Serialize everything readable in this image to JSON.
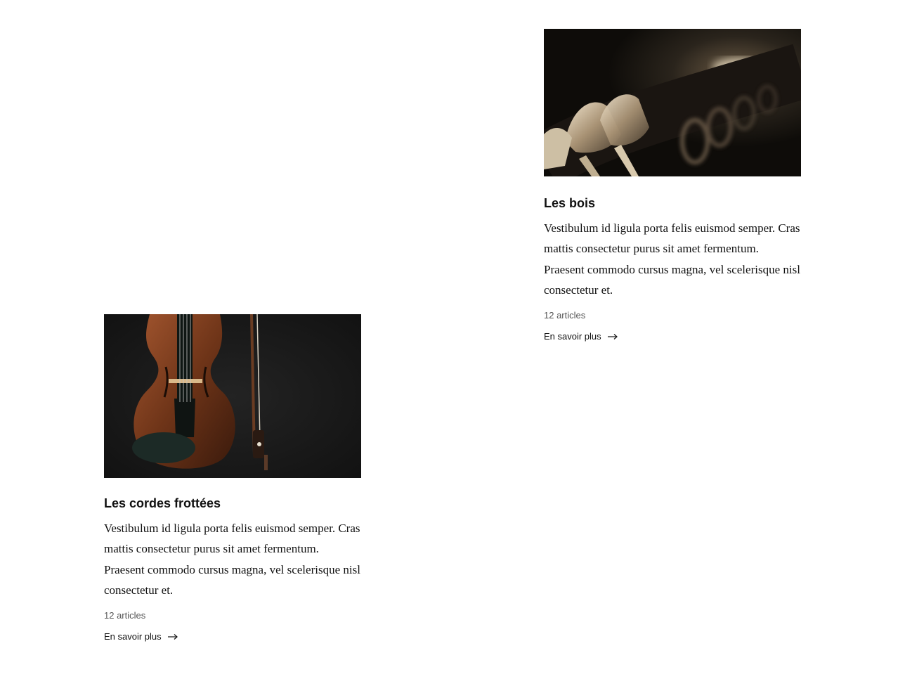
{
  "cards": [
    {
      "id": "bois",
      "image_icon": "clarinet-keys-photo",
      "title": "Les bois",
      "description": "Vestibulum id ligula porta felis euismod semper. Cras mattis consectetur purus sit amet fermentum. Praesent commodo cursus magna, vel scelerisque nisl consectetur et.",
      "count": "12 articles",
      "link_label": "En savoir plus",
      "link_icon": "arrow-right-icon"
    },
    {
      "id": "cordes",
      "image_icon": "violin-photo",
      "title": "Les cordes frottées",
      "description": "Vestibulum id ligula porta felis euismod semper. Cras mattis consectetur purus sit amet fermentum. Praesent commodo cursus magna, vel scelerisque nisl consectetur et.",
      "count": "12 articles",
      "link_label": "En savoir plus",
      "link_icon": "arrow-right-icon"
    }
  ]
}
